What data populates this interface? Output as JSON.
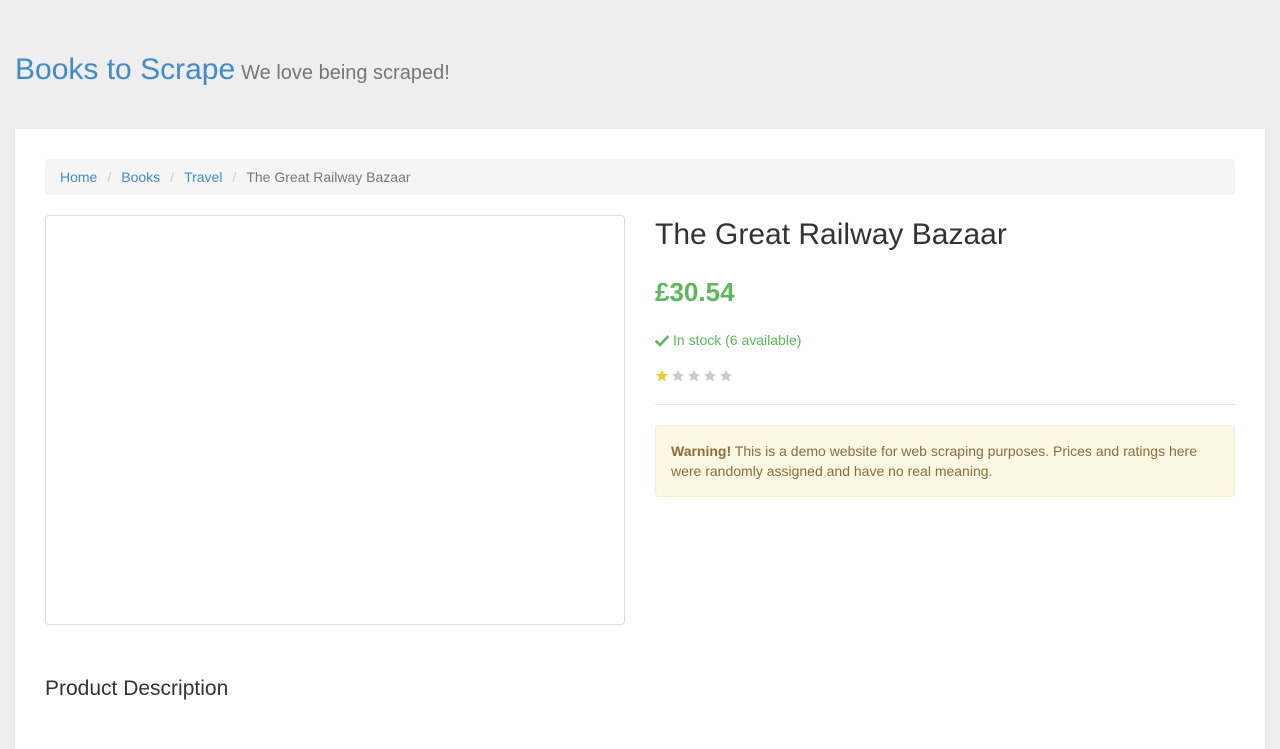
{
  "header": {
    "brand": "Books to Scrape",
    "tagline": "We love being scraped!"
  },
  "breadcrumb": {
    "items": [
      "Home",
      "Books",
      "Travel"
    ],
    "active": "The Great Railway Bazaar"
  },
  "product": {
    "title": "The Great Railway Bazaar",
    "price": "£30.54",
    "availability": "In stock (6 available)",
    "rating": 1,
    "rating_max": 5,
    "colors": {
      "price": "#5cb85c",
      "star_on": "#e6ce2e",
      "star_off": "#cccccc"
    }
  },
  "warning": {
    "label": "Warning!",
    "text": " This is a demo website for web scraping purposes. Prices and ratings here were randomly assigned and have no real meaning."
  },
  "sections": {
    "description_title": "Product Description"
  },
  "icons": {
    "availability": "check-icon",
    "rating": "star-icon"
  }
}
